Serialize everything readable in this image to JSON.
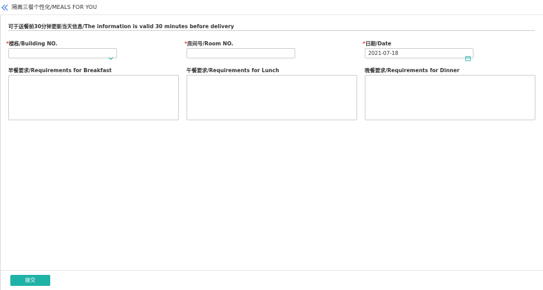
{
  "header": {
    "title": "隔离三餐个性化/MEALS FOR YOU"
  },
  "notice": {
    "text": "可于送餐前30分钟更新当天信息/The information is valid 30 minutes before delivery"
  },
  "form": {
    "building": {
      "label": "楼栋/Building NO.",
      "value": "",
      "required_mark": "*"
    },
    "room": {
      "label": "房间号/Room NO.",
      "value": "",
      "required_mark": "*"
    },
    "date": {
      "label": "日期/Date",
      "value": "2021-07-18",
      "required_mark": "*"
    },
    "breakfast": {
      "label": "早餐要求/Requirements for Breakfast",
      "value": ""
    },
    "lunch": {
      "label": "午餐要求/Requirements for Lunch",
      "value": ""
    },
    "dinner": {
      "label": "晚餐要求/Requirements for Dinner",
      "value": ""
    }
  },
  "footer": {
    "submit_label": "提交"
  },
  "colors": {
    "accent": "#1fb2a6",
    "required": "#e53935",
    "border": "#cfcfcf"
  },
  "icons": {
    "back": "double-chevron-left-icon",
    "dropdown": "chevron-down-icon",
    "date": "calendar-icon"
  }
}
